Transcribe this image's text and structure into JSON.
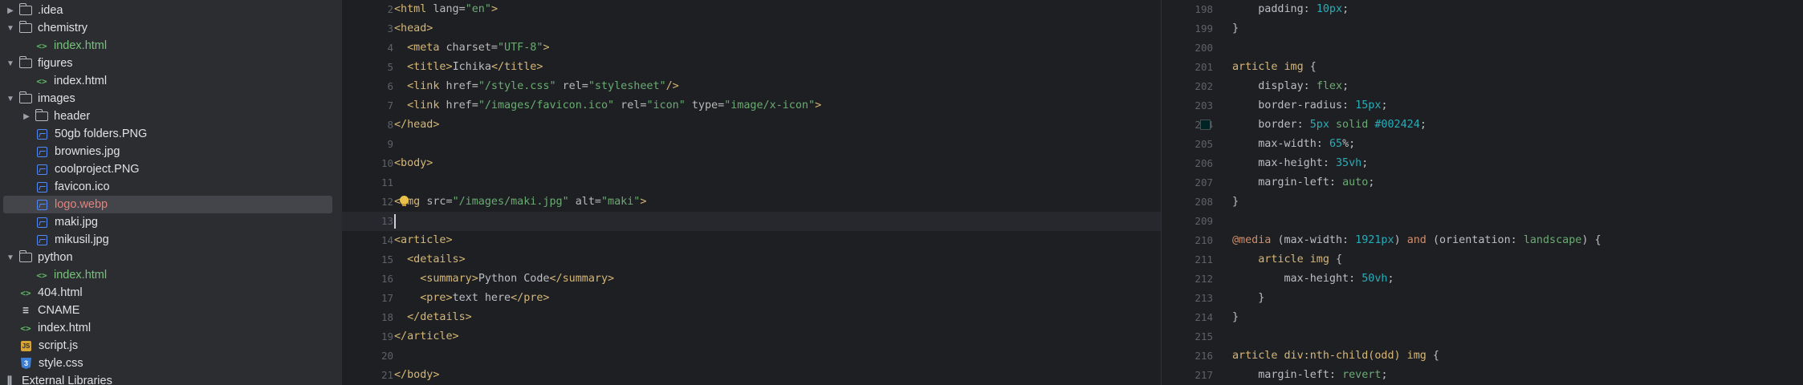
{
  "project_tree": {
    "items": [
      {
        "label": ".idea",
        "kind": "folder",
        "depth": 0,
        "expanded": false,
        "color": "normal"
      },
      {
        "label": "chemistry",
        "kind": "folder",
        "depth": 0,
        "expanded": true,
        "color": "normal"
      },
      {
        "label": "index.html",
        "kind": "html",
        "depth": 1,
        "color": "green"
      },
      {
        "label": "figures",
        "kind": "folder",
        "depth": 0,
        "expanded": true,
        "color": "normal"
      },
      {
        "label": "index.html",
        "kind": "html",
        "depth": 1,
        "color": "normal"
      },
      {
        "label": "images",
        "kind": "folder",
        "depth": 0,
        "expanded": true,
        "color": "normal"
      },
      {
        "label": "header",
        "kind": "folder",
        "depth": 1,
        "expanded": false,
        "color": "normal"
      },
      {
        "label": "50gb folders.PNG",
        "kind": "image",
        "depth": 1,
        "color": "normal"
      },
      {
        "label": "brownies.jpg",
        "kind": "image",
        "depth": 1,
        "color": "normal"
      },
      {
        "label": "coolproject.PNG",
        "kind": "image",
        "depth": 1,
        "color": "normal"
      },
      {
        "label": "favicon.ico",
        "kind": "image",
        "depth": 1,
        "color": "normal"
      },
      {
        "label": "logo.webp",
        "kind": "image",
        "depth": 1,
        "color": "red",
        "selected": true
      },
      {
        "label": "maki.jpg",
        "kind": "image",
        "depth": 1,
        "color": "normal"
      },
      {
        "label": "mikusil.jpg",
        "kind": "image",
        "depth": 1,
        "color": "normal"
      },
      {
        "label": "python",
        "kind": "folder",
        "depth": 0,
        "expanded": true,
        "color": "normal"
      },
      {
        "label": "index.html",
        "kind": "html",
        "depth": 1,
        "color": "green"
      },
      {
        "label": "404.html",
        "kind": "html",
        "depth": 0,
        "color": "normal"
      },
      {
        "label": "CNAME",
        "kind": "text",
        "depth": 0,
        "color": "normal"
      },
      {
        "label": "index.html",
        "kind": "html",
        "depth": 0,
        "color": "normal"
      },
      {
        "label": "script.js",
        "kind": "js",
        "depth": 0,
        "color": "normal"
      },
      {
        "label": "style.css",
        "kind": "css",
        "depth": 0,
        "color": "normal"
      },
      {
        "label": "External Libraries",
        "kind": "library",
        "depth": -1,
        "color": "normal"
      }
    ]
  },
  "html_editor": {
    "current_line": "13",
    "lines": [
      {
        "n": "2",
        "tokens": [
          [
            "tag",
            "<html "
          ],
          [
            "attr",
            "lang="
          ],
          [
            "str",
            "\"en\""
          ],
          [
            "tag",
            ">"
          ]
        ]
      },
      {
        "n": "3",
        "tokens": [
          [
            "tag",
            "<head>"
          ]
        ]
      },
      {
        "n": "4",
        "tokens": [
          [
            "txt",
            "  "
          ],
          [
            "tag",
            "<meta "
          ],
          [
            "attr",
            "charset="
          ],
          [
            "str",
            "\"UTF-8\""
          ],
          [
            "tag",
            ">"
          ]
        ]
      },
      {
        "n": "5",
        "tokens": [
          [
            "txt",
            "  "
          ],
          [
            "tag",
            "<title>"
          ],
          [
            "txt",
            "Ichika"
          ],
          [
            "tag",
            "</title>"
          ]
        ]
      },
      {
        "n": "6",
        "tokens": [
          [
            "txt",
            "  "
          ],
          [
            "tag",
            "<link "
          ],
          [
            "attr",
            "href="
          ],
          [
            "str",
            "\"/style.css\""
          ],
          [
            "attr",
            " rel="
          ],
          [
            "str",
            "\"stylesheet\""
          ],
          [
            "tag",
            "/>"
          ]
        ]
      },
      {
        "n": "7",
        "tokens": [
          [
            "txt",
            "  "
          ],
          [
            "tag",
            "<link "
          ],
          [
            "attr",
            "href="
          ],
          [
            "str",
            "\"/images/favicon.ico\""
          ],
          [
            "attr",
            " rel="
          ],
          [
            "str",
            "\"icon\""
          ],
          [
            "attr",
            " type="
          ],
          [
            "str",
            "\"image/x-icon\""
          ],
          [
            "tag",
            ">"
          ]
        ]
      },
      {
        "n": "8",
        "tokens": [
          [
            "tag",
            "</head>"
          ]
        ]
      },
      {
        "n": "9",
        "tokens": []
      },
      {
        "n": "10",
        "tokens": [
          [
            "tag",
            "<body>"
          ]
        ]
      },
      {
        "n": "11",
        "tokens": []
      },
      {
        "n": "12",
        "tokens": [
          [
            "tag",
            "<img "
          ],
          [
            "attr",
            "src="
          ],
          [
            "str",
            "\"/images/maki.jpg\""
          ],
          [
            "attr",
            " alt="
          ],
          [
            "str",
            "\"maki\""
          ],
          [
            "tag",
            ">"
          ]
        ]
      },
      {
        "n": "13",
        "tokens": []
      },
      {
        "n": "14",
        "tokens": [
          [
            "tag",
            "<article>"
          ]
        ]
      },
      {
        "n": "15",
        "tokens": [
          [
            "txt",
            "  "
          ],
          [
            "tag",
            "<details>"
          ]
        ]
      },
      {
        "n": "16",
        "tokens": [
          [
            "txt",
            "    "
          ],
          [
            "tag",
            "<summary>"
          ],
          [
            "txt",
            "Python Code"
          ],
          [
            "tag",
            "</summary>"
          ]
        ]
      },
      {
        "n": "17",
        "tokens": [
          [
            "txt",
            "    "
          ],
          [
            "tag",
            "<pre>"
          ],
          [
            "txt",
            "text here"
          ],
          [
            "tag",
            "</pre>"
          ]
        ]
      },
      {
        "n": "18",
        "tokens": [
          [
            "txt",
            "  "
          ],
          [
            "tag",
            "</details>"
          ]
        ]
      },
      {
        "n": "19",
        "tokens": [
          [
            "tag",
            "</article>"
          ]
        ]
      },
      {
        "n": "20",
        "tokens": []
      },
      {
        "n": "21",
        "tokens": [
          [
            "tag",
            "</body>"
          ]
        ]
      }
    ]
  },
  "css_editor": {
    "swatch_color": "#002424",
    "lines": [
      {
        "n": "198",
        "tokens": [
          [
            "txt",
            "    "
          ],
          [
            "prop",
            "padding: "
          ],
          [
            "num",
            "10px"
          ],
          [
            "txt",
            ";"
          ]
        ]
      },
      {
        "n": "199",
        "tokens": [
          [
            "txt",
            "}"
          ]
        ]
      },
      {
        "n": "200",
        "tokens": []
      },
      {
        "n": "201",
        "tokens": [
          [
            "sel",
            "article img"
          ],
          [
            "txt",
            " {"
          ]
        ]
      },
      {
        "n": "202",
        "tokens": [
          [
            "txt",
            "    "
          ],
          [
            "prop",
            "display: "
          ],
          [
            "val",
            "flex"
          ],
          [
            "txt",
            ";"
          ]
        ]
      },
      {
        "n": "203",
        "tokens": [
          [
            "txt",
            "    "
          ],
          [
            "prop",
            "border-radius: "
          ],
          [
            "num",
            "15px"
          ],
          [
            "txt",
            ";"
          ]
        ]
      },
      {
        "n": "204",
        "tokens": [
          [
            "txt",
            "    "
          ],
          [
            "prop",
            "border: "
          ],
          [
            "num",
            "5px "
          ],
          [
            "val",
            "solid "
          ],
          [
            "num",
            "#002424"
          ],
          [
            "txt",
            ";"
          ]
        ]
      },
      {
        "n": "205",
        "tokens": [
          [
            "txt",
            "    "
          ],
          [
            "prop",
            "max-width: "
          ],
          [
            "num",
            "65"
          ],
          [
            "txt",
            "%;"
          ]
        ]
      },
      {
        "n": "206",
        "tokens": [
          [
            "txt",
            "    "
          ],
          [
            "prop",
            "max-height: "
          ],
          [
            "num",
            "35vh"
          ],
          [
            "txt",
            ";"
          ]
        ]
      },
      {
        "n": "207",
        "tokens": [
          [
            "txt",
            "    "
          ],
          [
            "prop",
            "margin-left: "
          ],
          [
            "val",
            "auto"
          ],
          [
            "txt",
            ";"
          ]
        ]
      },
      {
        "n": "208",
        "tokens": [
          [
            "txt",
            "}"
          ]
        ]
      },
      {
        "n": "209",
        "tokens": []
      },
      {
        "n": "210",
        "tokens": [
          [
            "at",
            "@media "
          ],
          [
            "txt",
            "(max-width: "
          ],
          [
            "num",
            "1921px"
          ],
          [
            "txt",
            ") "
          ],
          [
            "kw",
            "and "
          ],
          [
            "txt",
            "(orientation: "
          ],
          [
            "val",
            "landscape"
          ],
          [
            "txt",
            ") {"
          ]
        ]
      },
      {
        "n": "211",
        "tokens": [
          [
            "txt",
            "    "
          ],
          [
            "sel",
            "article img"
          ],
          [
            "txt",
            " {"
          ]
        ]
      },
      {
        "n": "212",
        "tokens": [
          [
            "txt",
            "        "
          ],
          [
            "prop",
            "max-height: "
          ],
          [
            "num",
            "50vh"
          ],
          [
            "txt",
            ";"
          ]
        ]
      },
      {
        "n": "213",
        "tokens": [
          [
            "txt",
            "    }"
          ]
        ]
      },
      {
        "n": "214",
        "tokens": [
          [
            "txt",
            "}"
          ]
        ]
      },
      {
        "n": "215",
        "tokens": []
      },
      {
        "n": "216",
        "tokens": [
          [
            "sel",
            "article div:nth-child(odd) img"
          ],
          [
            "txt",
            " {"
          ]
        ]
      },
      {
        "n": "217",
        "tokens": [
          [
            "txt",
            "    "
          ],
          [
            "prop",
            "margin-left: "
          ],
          [
            "val",
            "revert"
          ],
          [
            "txt",
            ";"
          ]
        ]
      }
    ]
  }
}
